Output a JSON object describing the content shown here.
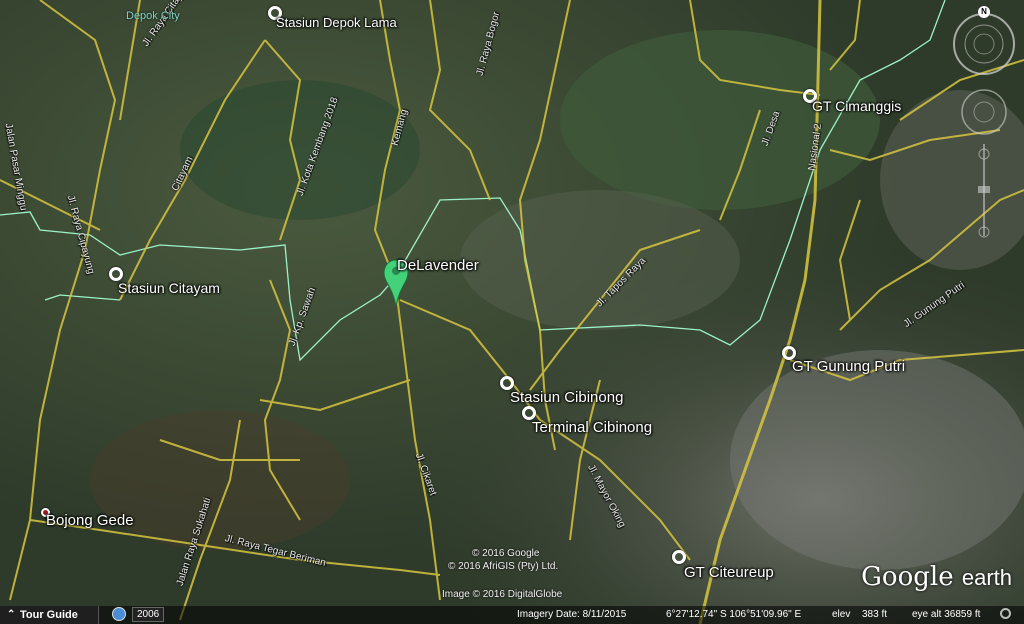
{
  "places": {
    "depok_city": "Depok City",
    "stasiun_depok_lama": "Stasiun Depok Lama",
    "gt_cimanggis": "GT Cimanggis",
    "delavender": "DeLavender",
    "stasiun_citayam": "Stasiun Citayam",
    "gt_gunung_putri": "GT Gunung Putri",
    "stasiun_cibinong": "Stasiun Cibinong",
    "terminal_cibinong": "Terminal Cibinong",
    "bojong_gede": "Bojong Gede",
    "gt_citeureup": "GT Citeureup"
  },
  "roads": {
    "jalan_pasar_minggu": "Jalan Pasar Minggu",
    "jl_raya_citayam_top": "Jl. Raya Citayam",
    "jl_raya_cipayung": "Jl. Raya Cipayung",
    "citayam": "Citayam",
    "jl_kota_kembang": "Jl. Kota Kembang 2018",
    "kemang": "Kemang",
    "jl_raya_bogor": "Jl. Raya Bogor",
    "jl_desa": "Jl. Desa",
    "nasional2": "Nasional 2",
    "jl_tapos_raya": "Jl. Tapos Raya",
    "jl_gunung_putri": "Jl. Gunung Putri",
    "jl_kp_sawah": "Jl. Kp. Sawah",
    "jl_cikaret": "Jl. Cikaret",
    "jl_mayor_oking": "Jl. Mayor Oking",
    "jalan_raya_sukahati": "Jalan Raya Sukahati",
    "jl_raya_tegar_beriman": "Jl. Raya Tegar Beriman"
  },
  "credits": {
    "google": "© 2016 Google",
    "afrigis": "© 2016 AfriGIS (Pty) Ltd.",
    "digitalglobe": "Image © 2016 DigitalGlobe"
  },
  "logo": {
    "google": "Google",
    "earth": "earth"
  },
  "status": {
    "tour_guide": "Tour Guide",
    "year": "2006",
    "imagery_date": "Imagery Date: 8/11/2015",
    "coords": "6°27'12.74\" S  106°51'09.96\" E",
    "elev_label": "elev",
    "elev_value": "383 ft",
    "eye_alt": "eye alt  36859 ft"
  },
  "compass": {
    "north": "N"
  },
  "colors": {
    "road": "#d8c640",
    "boundary": "#9df2c8",
    "pin_green": "#43d17a"
  }
}
